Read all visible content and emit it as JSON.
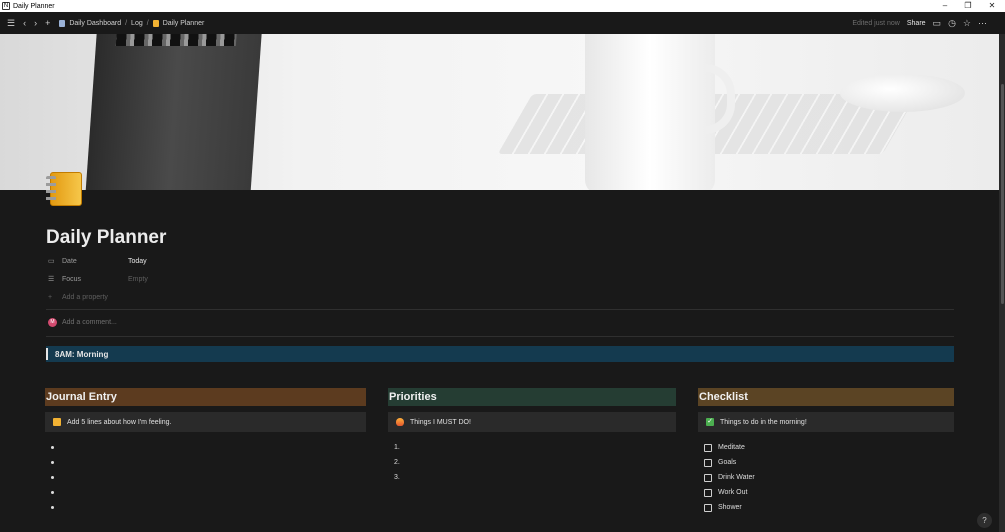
{
  "window": {
    "title": "Daily Planner"
  },
  "topbar": {
    "breadcrumbs": [
      "Daily Dashboard",
      "Log",
      "Daily Planner"
    ],
    "edited": "Edited just now",
    "share": "Share"
  },
  "page": {
    "title": "Daily Planner",
    "properties": [
      {
        "name": "Date",
        "value": "Today",
        "icon": "calendar-icon"
      },
      {
        "name": "Focus",
        "value": "Empty",
        "icon": "list-icon"
      }
    ],
    "add_property": "Add a property",
    "comment_avatar": "M",
    "comment_placeholder": "Add a comment...",
    "time_block": "8AM: Morning"
  },
  "columns": {
    "journal": {
      "title": "Journal Entry",
      "color": "#5c3b1f",
      "callout": "Add 5 lines about how I'm feeling.",
      "callout_icon": "notebook-icon",
      "bullets": 5
    },
    "priorities": {
      "title": "Priorities",
      "color": "#253d33",
      "callout": "Things I MUST DO!",
      "callout_icon": "fire-icon",
      "numbers": [
        "1.",
        "2.",
        "3."
      ]
    },
    "checklist": {
      "title": "Checklist",
      "color": "#5b4424",
      "callout": "Things to do in the morning!",
      "callout_icon": "check-icon",
      "items": [
        "Meditate",
        "Goals",
        "Drink Water",
        "Work Out",
        "Shower"
      ]
    }
  },
  "help": "?"
}
